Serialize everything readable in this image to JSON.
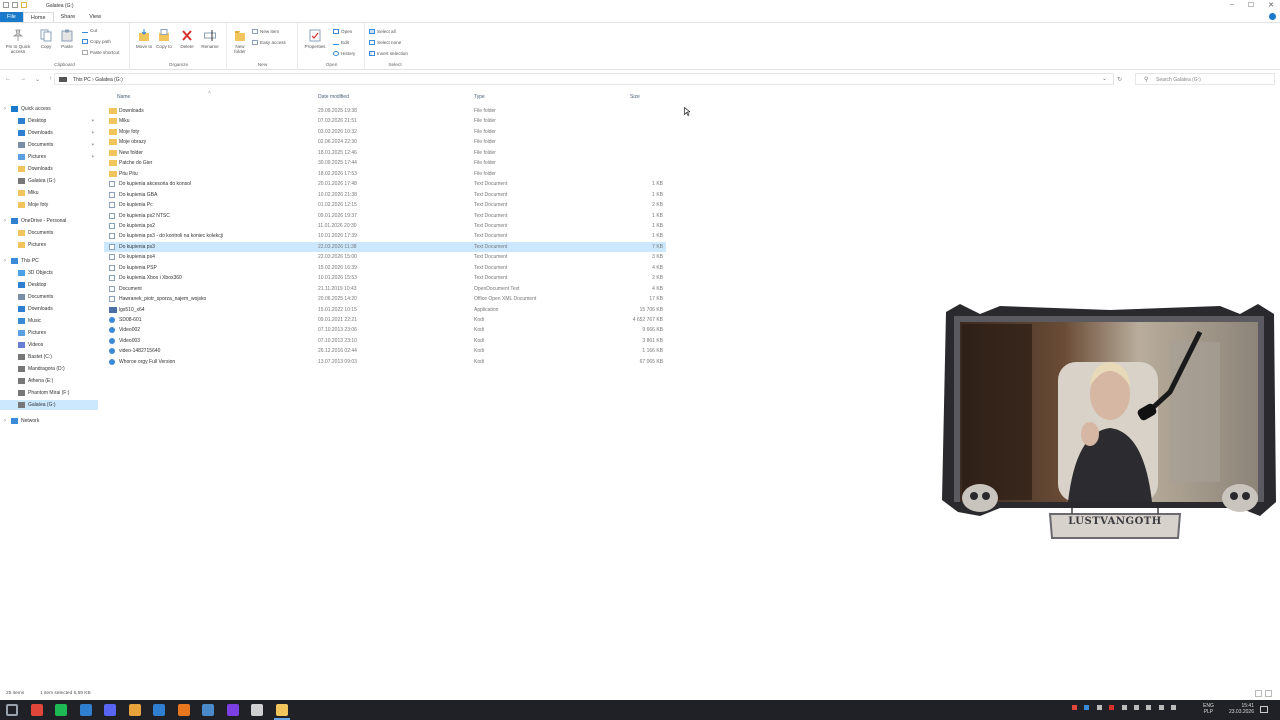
{
  "window": {
    "title": "Galatea (G:)",
    "controls": [
      "–",
      "☐",
      "✕"
    ]
  },
  "ribbon_tabs": [
    "File",
    "Home",
    "Share",
    "View"
  ],
  "ribbon": {
    "clipboard": {
      "label": "Clipboard",
      "pin": "Pin to Quick access",
      "copy": "Copy",
      "paste": "Paste",
      "cut": "Cut",
      "copy_path": "Copy path",
      "paste_shortcut": "Paste shortcut"
    },
    "organize": {
      "label": "Organize",
      "move_to": "Move to",
      "copy_to": "Copy to",
      "delete": "Delete",
      "rename": "Rename"
    },
    "new": {
      "label": "New",
      "new_folder": "New folder",
      "new_item": "New item",
      "easy_access": "Easy access"
    },
    "open": {
      "label": "Open",
      "properties": "Properties",
      "open": "Open",
      "edit": "Edit",
      "history": "History"
    },
    "select": {
      "label": "Select",
      "select_all": "Select all",
      "select_none": "Select none",
      "invert": "Invert selection"
    }
  },
  "address": {
    "path": "This PC  ›  Galatea (G:)",
    "search_placeholder": "Search Galatea (G:)"
  },
  "nav": [
    {
      "label": "Quick access",
      "level": 0,
      "icon": "star-icon",
      "color": "#1979ca"
    },
    {
      "label": "Desktop",
      "level": 1,
      "icon": "desktop-icon",
      "color": "#2f7fd1",
      "pin": true
    },
    {
      "label": "Downloads",
      "level": 1,
      "icon": "download-icon",
      "color": "#2f7fd1",
      "pin": true
    },
    {
      "label": "Documents",
      "level": 1,
      "icon": "documents-icon",
      "color": "#7a8fa6",
      "pin": true
    },
    {
      "label": "Pictures",
      "level": 1,
      "icon": "pictures-icon",
      "color": "#5aa0de",
      "pin": true
    },
    {
      "label": "Downloads",
      "level": 1,
      "icon": "folder-icon",
      "color": "#f2c55c"
    },
    {
      "label": "Galatea (G:)",
      "level": 1,
      "icon": "drive-icon",
      "color": "#777777"
    },
    {
      "label": "Miku",
      "level": 1,
      "icon": "folder-icon",
      "color": "#f2c55c"
    },
    {
      "label": "Moje foty",
      "level": 1,
      "icon": "folder-icon",
      "color": "#f2c55c"
    },
    {
      "label": "OneDrive - Personal",
      "level": 0,
      "icon": "cloud-icon",
      "color": "#2f7fd1"
    },
    {
      "label": "Documents",
      "level": 1,
      "icon": "folder-icon",
      "color": "#f2c55c"
    },
    {
      "label": "Pictures",
      "level": 1,
      "icon": "folder-icon",
      "color": "#f2c55c"
    },
    {
      "label": "This PC",
      "level": 0,
      "icon": "computer-icon",
      "color": "#3a8ad8"
    },
    {
      "label": "3D Objects",
      "level": 1,
      "icon": "cube-icon",
      "color": "#4aa0e6"
    },
    {
      "label": "Desktop",
      "level": 1,
      "icon": "desktop-icon",
      "color": "#2f7fd1"
    },
    {
      "label": "Documents",
      "level": 1,
      "icon": "documents-icon",
      "color": "#7a8fa6"
    },
    {
      "label": "Downloads",
      "level": 1,
      "icon": "download-icon",
      "color": "#2f7fd1"
    },
    {
      "label": "Music",
      "level": 1,
      "icon": "music-icon",
      "color": "#3a8ad8"
    },
    {
      "label": "Pictures",
      "level": 1,
      "icon": "pictures-icon",
      "color": "#5aa0de"
    },
    {
      "label": "Videos",
      "level": 1,
      "icon": "videos-icon",
      "color": "#6a7ed8"
    },
    {
      "label": "Bastet (C:)",
      "level": 1,
      "icon": "drive-icon",
      "color": "#777777"
    },
    {
      "label": "Mandragora (D:)",
      "level": 1,
      "icon": "drive-icon",
      "color": "#777777"
    },
    {
      "label": "Athena (E:)",
      "level": 1,
      "icon": "drive-icon",
      "color": "#777777"
    },
    {
      "label": "Phantom Mirai (F:)",
      "level": 1,
      "icon": "drive-icon",
      "color": "#777777"
    },
    {
      "label": "Galatea (G:)",
      "level": 1,
      "icon": "drive-icon",
      "color": "#777777",
      "selected": true
    },
    {
      "label": "Network",
      "level": 0,
      "icon": "network-icon",
      "color": "#3a8ad8"
    }
  ],
  "columns": {
    "name": "Name",
    "date": "Date modified",
    "type": "Type",
    "size": "Size"
  },
  "files": [
    {
      "name": "Downloads",
      "date": "29.09.2025 19:38",
      "type": "File folder",
      "size": "",
      "icon": "folder"
    },
    {
      "name": "Miku",
      "date": "07.03.2026 21:51",
      "type": "File folder",
      "size": "",
      "icon": "folder"
    },
    {
      "name": "Moje foty",
      "date": "03.03.2026 10:32",
      "type": "File folder",
      "size": "",
      "icon": "folder"
    },
    {
      "name": "Moje obrazy",
      "date": "02.06.2024 22:30",
      "type": "File folder",
      "size": "",
      "icon": "folder"
    },
    {
      "name": "New folder",
      "date": "18.01.2025 12:46",
      "type": "File folder",
      "size": "",
      "icon": "folder"
    },
    {
      "name": "Patche do Gier",
      "date": "30.09.2025 17:44",
      "type": "File folder",
      "size": "",
      "icon": "folder"
    },
    {
      "name": "Pitu Pitu",
      "date": "18.02.2026 17:53",
      "type": "File folder",
      "size": "",
      "icon": "folder"
    },
    {
      "name": "Do kupienia akcesoria do konsol",
      "date": "20.01.2026 17:48",
      "type": "Text Document",
      "size": "1 KB",
      "icon": "text"
    },
    {
      "name": "Do kupienia GBA",
      "date": "10.02.2026 21:38",
      "type": "Text Document",
      "size": "1 KB",
      "icon": "text"
    },
    {
      "name": "Do kupienia Pc",
      "date": "01.02.2026 12:15",
      "type": "Text Document",
      "size": "2 KB",
      "icon": "text"
    },
    {
      "name": "Do kupienia ps2 NTSC",
      "date": "09.01.2026 19:37",
      "type": "Text Document",
      "size": "1 KB",
      "icon": "text"
    },
    {
      "name": "Do kupienia ps2",
      "date": "11.01.2026 20:30",
      "type": "Text Document",
      "size": "1 KB",
      "icon": "text"
    },
    {
      "name": "Do kupienia ps3 - do kontroli na koniec kolekcji",
      "date": "10.01.2026 17:39",
      "type": "Text Document",
      "size": "1 KB",
      "icon": "text"
    },
    {
      "name": "Do kupienia ps3",
      "date": "22.03.2026 11:38",
      "type": "Text Document",
      "size": "7 KB",
      "icon": "text",
      "selected": true
    },
    {
      "name": "Do kupienia ps4",
      "date": "22.03.2026 15:00",
      "type": "Text Document",
      "size": "3 KB",
      "icon": "text"
    },
    {
      "name": "Do kupienia PSP",
      "date": "15.02.2026 16:39",
      "type": "Text Document",
      "size": "4 KB",
      "icon": "text"
    },
    {
      "name": "Do kupienia Xbox i Xbox360",
      "date": "10.01.2026 15:53",
      "type": "Text Document",
      "size": "2 KB",
      "icon": "text"
    },
    {
      "name": "Document",
      "date": "21.11.2019 10:43",
      "type": "OpenDocument Text",
      "size": "4 KB",
      "icon": "text"
    },
    {
      "name": "Hawranek_piotr_sporza_najem_wojsko",
      "date": "20.06.2025 14:20",
      "type": "Office Open XML Document",
      "size": "17 KB",
      "icon": "text"
    },
    {
      "name": "lgs510_x64",
      "date": "15.01.2022 10:15",
      "type": "Application",
      "size": "15 706 KB",
      "icon": "app"
    },
    {
      "name": "SD08-601",
      "date": "09.01.2021 22:21",
      "type": "Kodi",
      "size": "4 652 767 KB",
      "icon": "media"
    },
    {
      "name": "Video002",
      "date": "07.10.2013 23:06",
      "type": "Kodi",
      "size": "9 666 KB",
      "icon": "media"
    },
    {
      "name": "Video003",
      "date": "07.10.2013 23:10",
      "type": "Kodi",
      "size": "3 861 KB",
      "icon": "media"
    },
    {
      "name": "video-1482715640",
      "date": "26.12.2016 02:44",
      "type": "Kodi",
      "size": "1 166 KB",
      "icon": "media"
    },
    {
      "name": "Whoroe orgy Full Version",
      "date": "13.07.2013 09:03",
      "type": "Kodi",
      "size": "67 065 KB",
      "icon": "media"
    }
  ],
  "status": {
    "items": "25 items",
    "selected": "1 item selected  6,59 KB"
  },
  "webcam": {
    "nameplate": "LUSTVANGOTH"
  },
  "taskbar": {
    "icons": [
      {
        "name": "start-icon",
        "color": "#9aa3ad"
      },
      {
        "name": "chrome-icon",
        "color": "#e0463a"
      },
      {
        "name": "spotify-icon",
        "color": "#1db954"
      },
      {
        "name": "edge-icon",
        "color": "#2f7fd1"
      },
      {
        "name": "discord-icon",
        "color": "#5865f2"
      },
      {
        "name": "app-icon",
        "color": "#e8a33a"
      },
      {
        "name": "calendar-icon",
        "color": "#2f7fd1"
      },
      {
        "name": "vlc-icon",
        "color": "#e8761d"
      },
      {
        "name": "steam-icon",
        "color": "#4a8ac8"
      },
      {
        "name": "obs-icon",
        "color": "#7b3fe4"
      },
      {
        "name": "tool-icon",
        "color": "#cfcfcf"
      },
      {
        "name": "file-explorer-icon",
        "color": "#f2c55c"
      }
    ],
    "lang_top": "ENG",
    "lang_bottom": "PLP",
    "time": "15:41",
    "date": "23.03.2026"
  }
}
